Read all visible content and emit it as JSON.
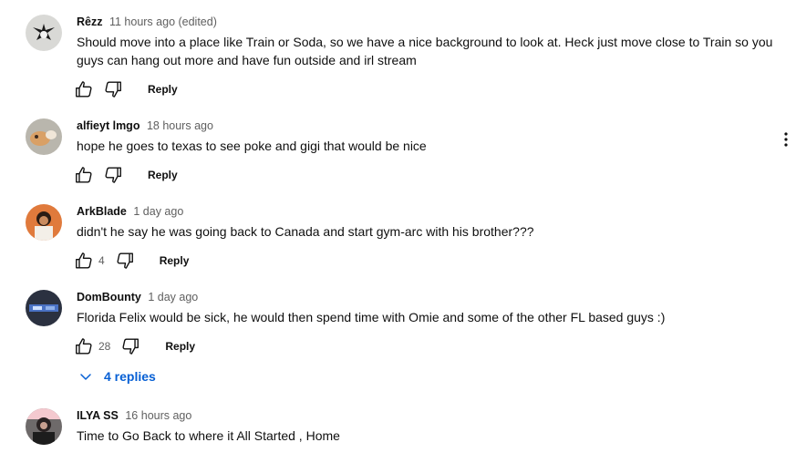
{
  "comments": [
    {
      "author": "Rêzz",
      "time": "11 hours ago (edited)",
      "text": "Should move into a place like Train or Soda, so we have a nice background to look at. Heck just move close to Train so you guys can hang out more and have fun outside and irl stream",
      "likes": "",
      "reply_label": "Reply"
    },
    {
      "author": "alfieyt lmgo",
      "time": "18 hours ago",
      "text": "hope he goes to texas to see poke and gigi that would be nice",
      "likes": "",
      "reply_label": "Reply"
    },
    {
      "author": "ArkBlade",
      "time": "1 day ago",
      "text": "didn't he say he was going back to Canada and start gym-arc with his brother???",
      "likes": "4",
      "reply_label": "Reply"
    },
    {
      "author": "DomBounty",
      "time": "1 day ago",
      "text": "Florida Felix would be sick, he would then spend time with Omie and some of the other FL based guys :)",
      "likes": "28",
      "reply_label": "Reply",
      "replies_label": "4 replies"
    },
    {
      "author": "ILYA SS",
      "time": "16 hours ago",
      "text": "Time to Go Back to where it All Started , Home",
      "likes": "",
      "reply_label": "Reply"
    }
  ],
  "icons": {
    "like": "thumbs-up-icon",
    "dislike": "thumbs-down-icon",
    "menu": "more-vert-icon",
    "expand": "chevron-down-icon"
  },
  "colors": {
    "link_blue": "#065fd4",
    "meta_gray": "#606060"
  }
}
